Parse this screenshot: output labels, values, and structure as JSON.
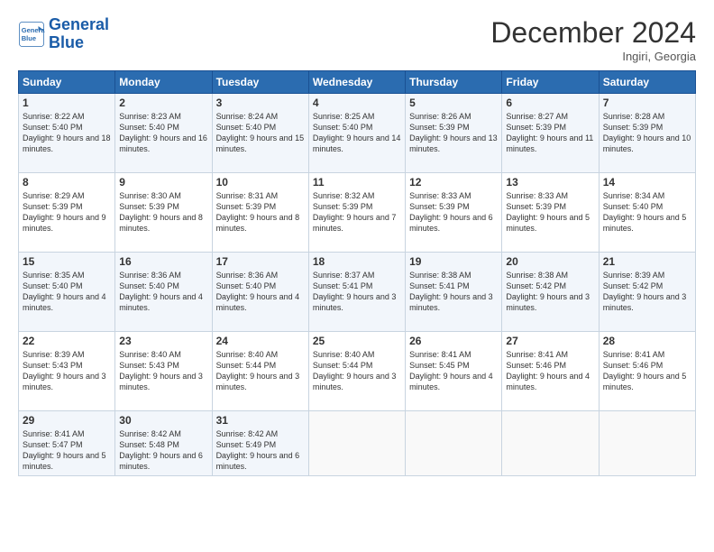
{
  "logo": {
    "line1": "General",
    "line2": "Blue"
  },
  "title": "December 2024",
  "location": "Ingiri, Georgia",
  "days_of_week": [
    "Sunday",
    "Monday",
    "Tuesday",
    "Wednesday",
    "Thursday",
    "Friday",
    "Saturday"
  ],
  "weeks": [
    [
      {
        "day": "1",
        "sunrise": "8:22 AM",
        "sunset": "5:40 PM",
        "daylight": "9 hours and 18 minutes."
      },
      {
        "day": "2",
        "sunrise": "8:23 AM",
        "sunset": "5:40 PM",
        "daylight": "9 hours and 16 minutes."
      },
      {
        "day": "3",
        "sunrise": "8:24 AM",
        "sunset": "5:40 PM",
        "daylight": "9 hours and 15 minutes."
      },
      {
        "day": "4",
        "sunrise": "8:25 AM",
        "sunset": "5:40 PM",
        "daylight": "9 hours and 14 minutes."
      },
      {
        "day": "5",
        "sunrise": "8:26 AM",
        "sunset": "5:39 PM",
        "daylight": "9 hours and 13 minutes."
      },
      {
        "day": "6",
        "sunrise": "8:27 AM",
        "sunset": "5:39 PM",
        "daylight": "9 hours and 11 minutes."
      },
      {
        "day": "7",
        "sunrise": "8:28 AM",
        "sunset": "5:39 PM",
        "daylight": "9 hours and 10 minutes."
      }
    ],
    [
      {
        "day": "8",
        "sunrise": "8:29 AM",
        "sunset": "5:39 PM",
        "daylight": "9 hours and 9 minutes."
      },
      {
        "day": "9",
        "sunrise": "8:30 AM",
        "sunset": "5:39 PM",
        "daylight": "9 hours and 8 minutes."
      },
      {
        "day": "10",
        "sunrise": "8:31 AM",
        "sunset": "5:39 PM",
        "daylight": "9 hours and 8 minutes."
      },
      {
        "day": "11",
        "sunrise": "8:32 AM",
        "sunset": "5:39 PM",
        "daylight": "9 hours and 7 minutes."
      },
      {
        "day": "12",
        "sunrise": "8:33 AM",
        "sunset": "5:39 PM",
        "daylight": "9 hours and 6 minutes."
      },
      {
        "day": "13",
        "sunrise": "8:33 AM",
        "sunset": "5:39 PM",
        "daylight": "9 hours and 5 minutes."
      },
      {
        "day": "14",
        "sunrise": "8:34 AM",
        "sunset": "5:40 PM",
        "daylight": "9 hours and 5 minutes."
      }
    ],
    [
      {
        "day": "15",
        "sunrise": "8:35 AM",
        "sunset": "5:40 PM",
        "daylight": "9 hours and 4 minutes."
      },
      {
        "day": "16",
        "sunrise": "8:36 AM",
        "sunset": "5:40 PM",
        "daylight": "9 hours and 4 minutes."
      },
      {
        "day": "17",
        "sunrise": "8:36 AM",
        "sunset": "5:40 PM",
        "daylight": "9 hours and 4 minutes."
      },
      {
        "day": "18",
        "sunrise": "8:37 AM",
        "sunset": "5:41 PM",
        "daylight": "9 hours and 3 minutes."
      },
      {
        "day": "19",
        "sunrise": "8:38 AM",
        "sunset": "5:41 PM",
        "daylight": "9 hours and 3 minutes."
      },
      {
        "day": "20",
        "sunrise": "8:38 AM",
        "sunset": "5:42 PM",
        "daylight": "9 hours and 3 minutes."
      },
      {
        "day": "21",
        "sunrise": "8:39 AM",
        "sunset": "5:42 PM",
        "daylight": "9 hours and 3 minutes."
      }
    ],
    [
      {
        "day": "22",
        "sunrise": "8:39 AM",
        "sunset": "5:43 PM",
        "daylight": "9 hours and 3 minutes."
      },
      {
        "day": "23",
        "sunrise": "8:40 AM",
        "sunset": "5:43 PM",
        "daylight": "9 hours and 3 minutes."
      },
      {
        "day": "24",
        "sunrise": "8:40 AM",
        "sunset": "5:44 PM",
        "daylight": "9 hours and 3 minutes."
      },
      {
        "day": "25",
        "sunrise": "8:40 AM",
        "sunset": "5:44 PM",
        "daylight": "9 hours and 3 minutes."
      },
      {
        "day": "26",
        "sunrise": "8:41 AM",
        "sunset": "5:45 PM",
        "daylight": "9 hours and 4 minutes."
      },
      {
        "day": "27",
        "sunrise": "8:41 AM",
        "sunset": "5:46 PM",
        "daylight": "9 hours and 4 minutes."
      },
      {
        "day": "28",
        "sunrise": "8:41 AM",
        "sunset": "5:46 PM",
        "daylight": "9 hours and 5 minutes."
      }
    ],
    [
      {
        "day": "29",
        "sunrise": "8:41 AM",
        "sunset": "5:47 PM",
        "daylight": "9 hours and 5 minutes."
      },
      {
        "day": "30",
        "sunrise": "8:42 AM",
        "sunset": "5:48 PM",
        "daylight": "9 hours and 6 minutes."
      },
      {
        "day": "31",
        "sunrise": "8:42 AM",
        "sunset": "5:49 PM",
        "daylight": "9 hours and 6 minutes."
      },
      null,
      null,
      null,
      null
    ]
  ]
}
